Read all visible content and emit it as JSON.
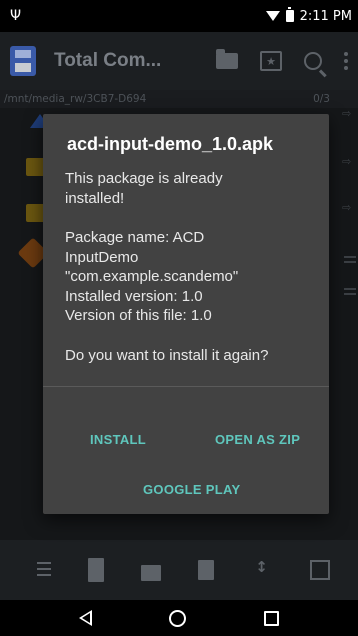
{
  "status_bar": {
    "time": "2:11 PM"
  },
  "toolbar": {
    "title": "Total Com..."
  },
  "panel": {
    "path": "/mnt/media_rw/3CB7-D694",
    "count": "0/3"
  },
  "dialog": {
    "title": "acd-input-demo_1.0.apk",
    "lines": [
      "This package is already",
      "installed!",
      "",
      "Package name: ACD",
      "InputDemo",
      "\"com.example.scandemo\"",
      "Installed version: 1.0",
      "Version of this file: 1.0",
      "",
      "Do you want to install it again?"
    ],
    "buttons": {
      "install": "INSTALL",
      "open_as_zip": "OPEN AS ZIP",
      "google_play": "GOOGLE PLAY"
    },
    "button_color": "#5fc7bd"
  },
  "icons": {
    "status": [
      "usb-icon",
      "wifi-icon",
      "battery-icon"
    ],
    "toolbar": [
      "app-icon",
      "folder-icon",
      "bookmark-star-icon",
      "search-icon",
      "overflow-menu-icon"
    ],
    "bottom": [
      "select-icon",
      "new-file-icon",
      "copy-icon",
      "delete-icon",
      "sort-icon",
      "dual-panel-icon"
    ],
    "nav": [
      "back-icon",
      "home-icon",
      "recents-icon"
    ]
  }
}
